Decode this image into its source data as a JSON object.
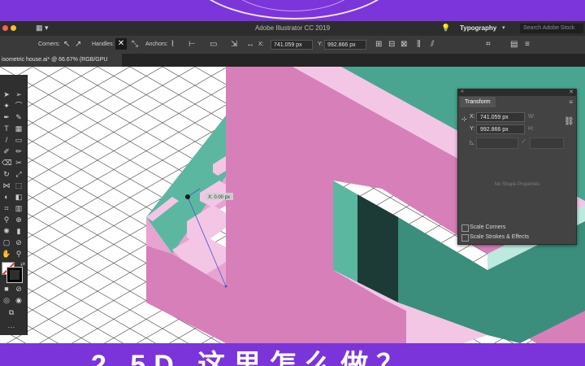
{
  "app": {
    "window_title": "Adobe Illustrator CC 2019",
    "workspace": "Typography",
    "search_placeholder": "Search Adobe Stock"
  },
  "control_bar": {
    "corners_label": "Corners:",
    "handles_label": "Handles:",
    "anchors_label": "Anchors:",
    "x_label": "X:",
    "x_value": "741.059 px",
    "y_label": "Y:",
    "y_value": "992.866 px"
  },
  "document_tab": {
    "label": "isometric house.ai* @ 66.67% (RGB/GPU Preview)"
  },
  "canvas": {
    "measure_tooltip": "X: 0.00 px"
  },
  "transform_panel": {
    "title": "Transform",
    "x_label": "X:",
    "x_value": "741.059 px",
    "y_label": "Y:",
    "y_value": "992.866 px",
    "no_shape": "No Shape Properties",
    "scale_corners": "Scale Corners",
    "scale_strokes": "Scale Strokes & Effects"
  },
  "banner": {
    "caption": "2.5D 这里怎么做？"
  },
  "colors": {
    "purple": "#7b34d9",
    "pink_wall": "#d77fb9",
    "light_pink": "#f3c6e6",
    "teal": "#49a590",
    "dark_teal": "#1d3b36"
  }
}
